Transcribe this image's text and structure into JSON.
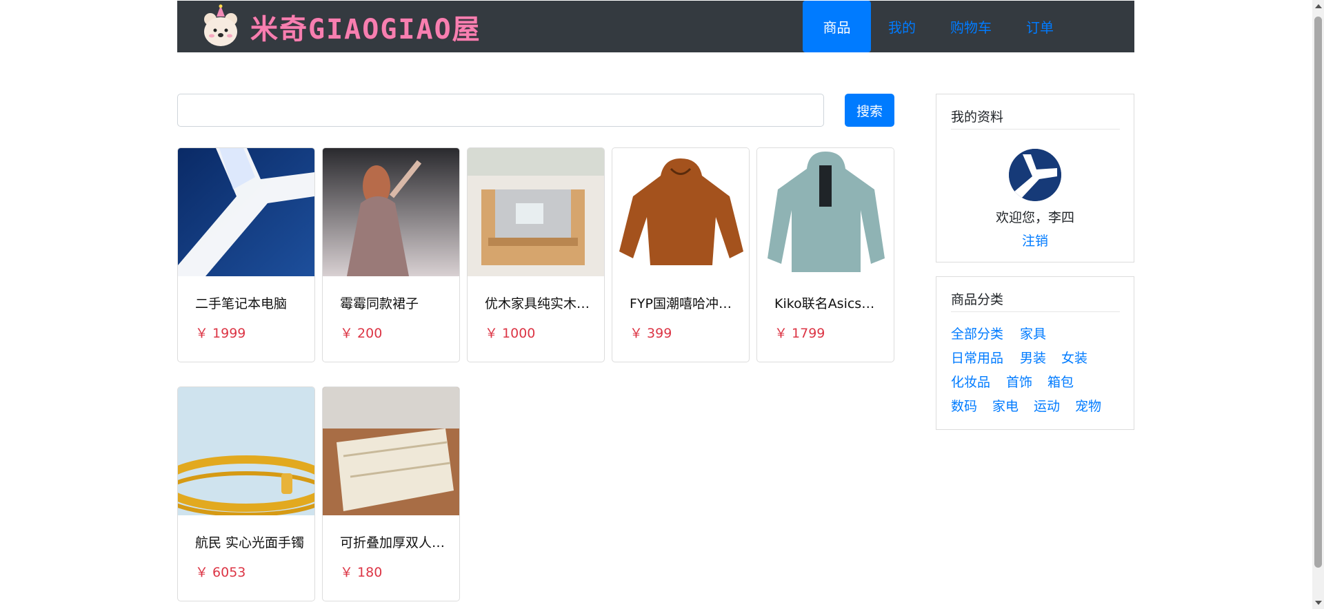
{
  "brand": {
    "name": "米奇GIAOGIAO屋"
  },
  "nav": {
    "items": [
      {
        "label": "商品"
      },
      {
        "label": "我的"
      },
      {
        "label": "购物车"
      },
      {
        "label": "订单"
      }
    ]
  },
  "search": {
    "value": "",
    "button_label": "搜索"
  },
  "products": [
    {
      "title": "二手笔记本电脑",
      "price": "￥ 1999"
    },
    {
      "title": "霉霉同款裙子",
      "price": "￥ 200"
    },
    {
      "title": "优木家具纯实木沙发",
      "price": "￥ 1000"
    },
    {
      "title": "FYP国潮嘻哈冲锋衣",
      "price": "￥ 399"
    },
    {
      "title": "Kiko联名Asics冲锋衣",
      "price": "￥ 1799"
    },
    {
      "title": "航民 实心光面手镯",
      "price": "￥ 6053"
    },
    {
      "title": "可折叠加厚双人床垫",
      "price": "￥ 180"
    }
  ],
  "profile": {
    "title": "我的资料",
    "welcome": "欢迎您，李四",
    "logout": "注销"
  },
  "categories": {
    "title": "商品分类",
    "items": [
      "全部分类",
      "家具",
      "日常用品",
      "男装",
      "女装",
      "化妆品",
      "首饰",
      "箱包",
      "数码",
      "家电",
      "运动",
      "宠物"
    ]
  },
  "colors": {
    "nav_bg": "#343a40",
    "accent": "#007bff",
    "price": "#dc3545",
    "brand_pink": "#f77fb0"
  }
}
